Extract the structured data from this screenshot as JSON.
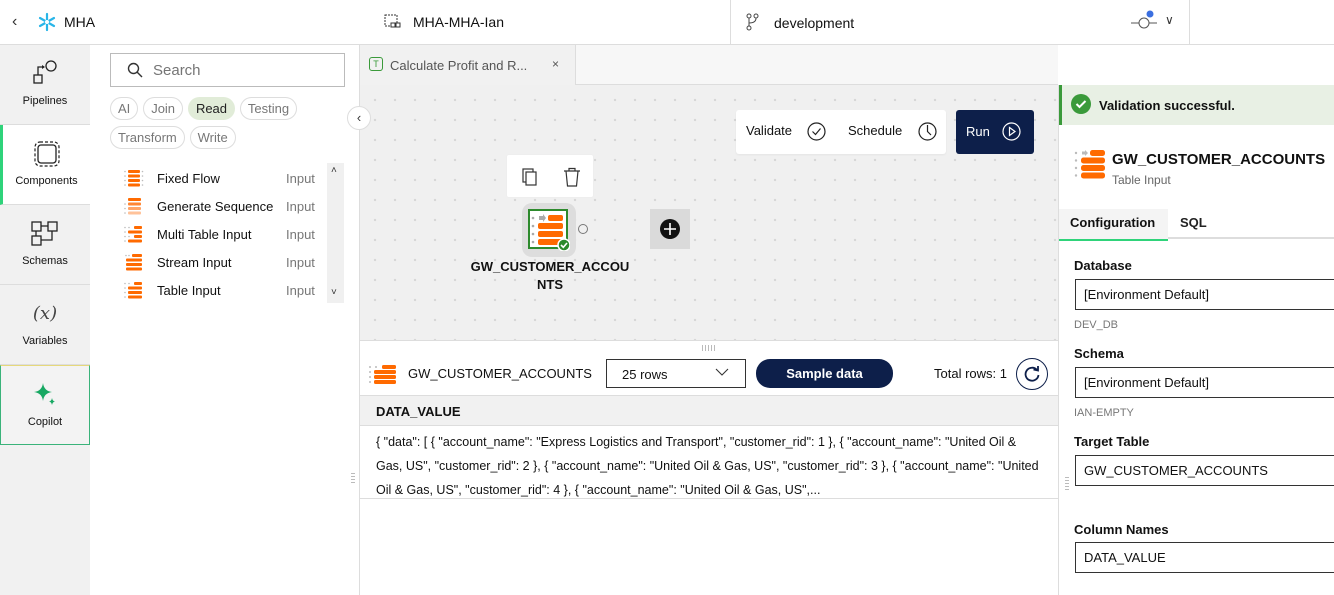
{
  "topbar": {
    "back_icon": "chevron-left-icon",
    "logo_icon": "snowflake-icon",
    "app_name": "MHA",
    "project_icon": "project-icon",
    "project_name": "MHA-MHA-Ian",
    "branch_icon": "git-branch-icon",
    "branch_name": "development",
    "commit_icon": "git-commit-icon",
    "notification_color": "#3b6fe0"
  },
  "leftnav": {
    "items": [
      {
        "label": "Pipelines",
        "icon": "pipelines-icon"
      },
      {
        "label": "Components",
        "icon": "components-icon",
        "active": true
      },
      {
        "label": "Schemas",
        "icon": "schemas-icon"
      },
      {
        "label": "Variables",
        "icon": "variables-icon",
        "glyph": "(x)"
      },
      {
        "label": "Copilot",
        "icon": "sparkle-icon"
      }
    ]
  },
  "components": {
    "search_placeholder": "Search",
    "filters": [
      {
        "label": "AI"
      },
      {
        "label": "Join"
      },
      {
        "label": "Read",
        "selected": true
      },
      {
        "label": "Testing"
      },
      {
        "label": "Transform"
      },
      {
        "label": "Write"
      }
    ],
    "items": [
      {
        "name": "Fixed Flow",
        "type": "Input"
      },
      {
        "name": "Generate Sequence",
        "type": "Input"
      },
      {
        "name": "Multi Table Input",
        "type": "Input"
      },
      {
        "name": "Stream Input",
        "type": "Input"
      },
      {
        "name": "Table Input",
        "type": "Input"
      }
    ]
  },
  "tabs": [
    {
      "badge": "T",
      "label": "Calculate Profit and R...",
      "close": "×"
    }
  ],
  "canvas": {
    "validate_label": "Validate",
    "schedule_label": "Schedule",
    "run_label": "Run",
    "node_label": "GW_CUSTOMER_ACCOUNTS",
    "node_status": "valid"
  },
  "sample": {
    "component_name": "GW_CUSTOMER_ACCOUNTS",
    "rows_option": "25 rows",
    "sample_button": "Sample data",
    "total_rows": "Total rows: 1",
    "columns": [
      "DATA_VALUE"
    ],
    "rows": [
      [
        "{ \"data\": [ { \"account_name\": \"Express Logistics and Transport\", \"customer_rid\": 1 }, { \"account_name\": \"United Oil & Gas, US\", \"customer_rid\": 2 }, { \"account_name\": \"United Oil & Gas, US\", \"customer_rid\": 3 }, { \"account_name\": \"United Oil & Gas, US\", \"customer_rid\": 4 }, { \"account_name\": \"United Oil & Gas, US\",..."
      ]
    ]
  },
  "properties": {
    "validation_message": "Validation successful.",
    "component_name": "GW_CUSTOMER_ACCOUNTS",
    "component_type": "Table Input",
    "tabs": [
      "Configuration",
      "SQL"
    ],
    "fields": {
      "database_label": "Database",
      "database_value": "[Environment Default]",
      "database_hint": "DEV_DB",
      "schema_label": "Schema",
      "schema_value": "[Environment Default]",
      "schema_hint": "IAN-EMPTY",
      "target_table_label": "Target Table",
      "target_table_value": "GW_CUSTOMER_ACCOUNTS",
      "column_names_label": "Column Names",
      "column_names_value": "DATA_VALUE"
    }
  },
  "colors": {
    "accent_green": "#2fd37a",
    "success_green": "#3a9a3a",
    "navy": "#0d1f4a",
    "orange": "#ff6a00"
  }
}
